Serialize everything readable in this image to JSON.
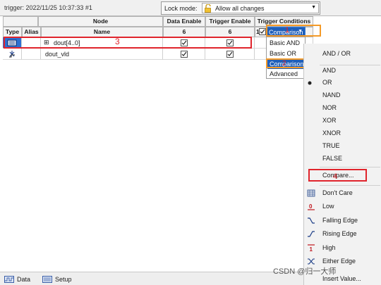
{
  "top": {
    "trigger_title": "trigger: 2022/11/25 10:37:33  #1",
    "lock_label": "Lock mode:",
    "lock_value": "Allow all changes"
  },
  "table": {
    "headers": {
      "type": "Type",
      "alias": "Alias",
      "node_group": "Node",
      "name": "Name",
      "data_enable": "Data Enable",
      "trigger_enable": "Trigger Enable",
      "trigger_conditions": "Trigger Conditions"
    },
    "counts": {
      "data_enable": "6",
      "trigger_enable": "6",
      "trigger_conditions": "1"
    },
    "rows": [
      {
        "name": "dout[4..0]",
        "expand": "⊞",
        "data_enable": true,
        "trigger_enable": true
      },
      {
        "name": "dout_vld",
        "data_enable": true,
        "trigger_enable": true
      }
    ]
  },
  "conditions": {
    "selected": "Comparison",
    "options": [
      "Basic AND",
      "Basic OR",
      "Comparison",
      "Advanced"
    ]
  },
  "context_menu": {
    "group_title": "AND / OR",
    "logic": [
      "AND",
      "OR",
      "NAND",
      "NOR",
      "XOR",
      "XNOR",
      "TRUE",
      "FALSE"
    ],
    "selected_logic": "OR",
    "compare": "Compare...",
    "conditions": [
      "Don't Care",
      "Low",
      "Falling Edge",
      "Rising Edge",
      "High",
      "Either Edge"
    ],
    "insert": "Insert Value..."
  },
  "annotations": [
    "1",
    "2",
    "3",
    "4"
  ],
  "tabs": [
    "Data",
    "Setup"
  ],
  "watermark": "CSDN @归一大师",
  "colors": {
    "selection_blue": "#1f5fba",
    "annotation_red": "#e0242c",
    "annotation_orange": "#f49a28"
  }
}
